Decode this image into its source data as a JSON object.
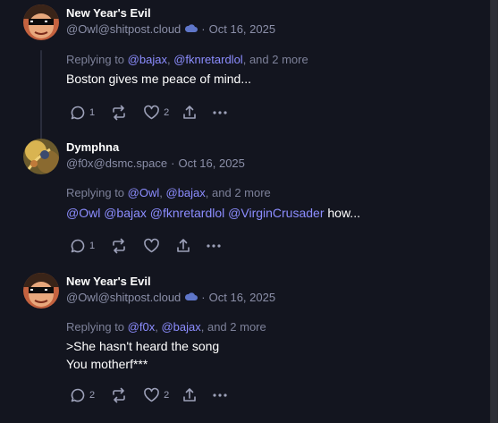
{
  "posts": [
    {
      "display_name": "New Year's Evil",
      "handle": "@Owl@shitpost.cloud",
      "separator": "·",
      "date": "Oct 16, 2025",
      "bot_icon": "cloud-icon",
      "reply_prefix": "Replying to",
      "reply_mentions": [
        "@bajax",
        "@fknretardlol"
      ],
      "reply_more": "and 2 more",
      "content": "Boston gives me peace of mind...",
      "counts": {
        "replies": "1",
        "boosts": "",
        "likes": "2"
      }
    },
    {
      "display_name": "Dymphna",
      "handle": "@f0x@dsmc.space",
      "separator": "·",
      "date": "Oct 16, 2025",
      "reply_prefix": "Replying to",
      "reply_mentions": [
        "@Owl",
        "@bajax"
      ],
      "reply_more": "and 2 more",
      "content_mentions": [
        "@Owl",
        "@bajax",
        "@fknretardlol",
        "@VirginCrusader"
      ],
      "content_tail": "how...",
      "counts": {
        "replies": "1",
        "boosts": "",
        "likes": ""
      }
    },
    {
      "display_name": "New Year's Evil",
      "handle": "@Owl@shitpost.cloud",
      "separator": "·",
      "date": "Oct 16, 2025",
      "bot_icon": "cloud-icon",
      "reply_prefix": "Replying to",
      "reply_mentions": [
        "@f0x",
        "@bajax"
      ],
      "reply_more": "and 2 more",
      "content_lines": [
        ">She hasn't heard the song",
        "You motherf***"
      ],
      "counts": {
        "replies": "2",
        "boosts": "",
        "likes": "2"
      }
    }
  ],
  "colors": {
    "background": "#13151f",
    "text": "#ffffff",
    "muted": "#8b8fa8",
    "mention": "#8c8dff",
    "icon": "#9da1b9"
  }
}
